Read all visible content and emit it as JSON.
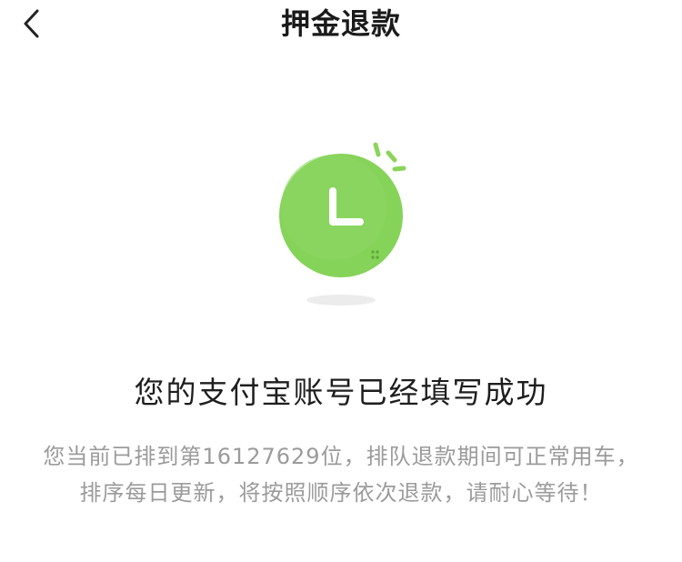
{
  "header": {
    "title": "押金退款",
    "back_icon": "chevron-left-icon"
  },
  "illustration": {
    "icon": "clock-icon",
    "accent_color": "#8bd45a",
    "circle_color": "#84d256"
  },
  "result": {
    "headline": "您的支付宝账号已经填写成功",
    "description": "您当前已排到第16127629位，排队退款期间可正常用车，排序每日更新，将按照顺序依次退款，请耐心等待！"
  },
  "colors": {
    "title_text": "#1a1a1a",
    "headline_text": "#1e1e1e",
    "description_text": "#9b9b9b"
  }
}
